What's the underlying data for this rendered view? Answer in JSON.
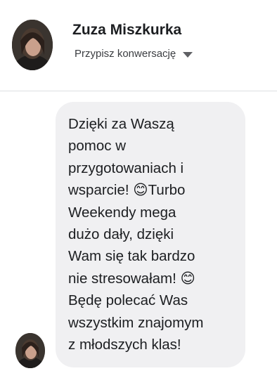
{
  "contact": {
    "name": "Zuza Miszkurka",
    "assign_label": "Przypisz konwersację"
  },
  "message": {
    "text": "Dzięki za Waszą\npomoc w\nprzygotowaniach i\nwsparcie! 😊Turbo\nWeekendy mega\ndużo dały, dzięki\nWam się tak bardzo\nnie stresowałam! 😊\nBędę polecać Was\nwszystkim znajomym\nz młodszych klas!"
  },
  "icons": {
    "assign_dropdown": "caret-down-icon"
  },
  "colors": {
    "bubble_background": "#f0f0f2",
    "name_text": "#1c1e21",
    "divider": "#dddfe2"
  }
}
